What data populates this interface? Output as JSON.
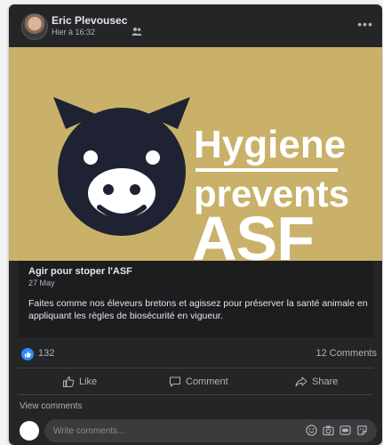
{
  "post": {
    "author": "Eric Plevousec",
    "time": "Hier à 16:32",
    "banner": {
      "line1": "Hygiene",
      "line2": "prevents",
      "line3": "ASF"
    },
    "link": {
      "title": "Agir pour stoper l'ASF",
      "date": "27 May",
      "body": "Faites comme nos éleveurs bretons et agissez pour préserver la santé animale en appliquant les règles de biosécurité en vigueur."
    },
    "like_count": "132",
    "comment_count": "12 Comments",
    "actions": {
      "like": "Like",
      "comment": "Comment",
      "share": "Share"
    },
    "view_comments": "View comments",
    "comment_placeholder": "Write comments..."
  },
  "colors": {
    "card_bg": "#242526",
    "banner_bg": "#c9b169",
    "pig": "#1f2233",
    "accent": "#2d88ff"
  },
  "icons": {
    "audience": "friends-icon",
    "more": "more-dots-icon",
    "like": "thumbs-up-icon",
    "comment": "speech-bubble-icon",
    "share": "share-arrow-icon",
    "emoji": "smiley-icon",
    "camera": "camera-icon",
    "gif": "gif-icon",
    "sticker": "sticker-icon"
  }
}
